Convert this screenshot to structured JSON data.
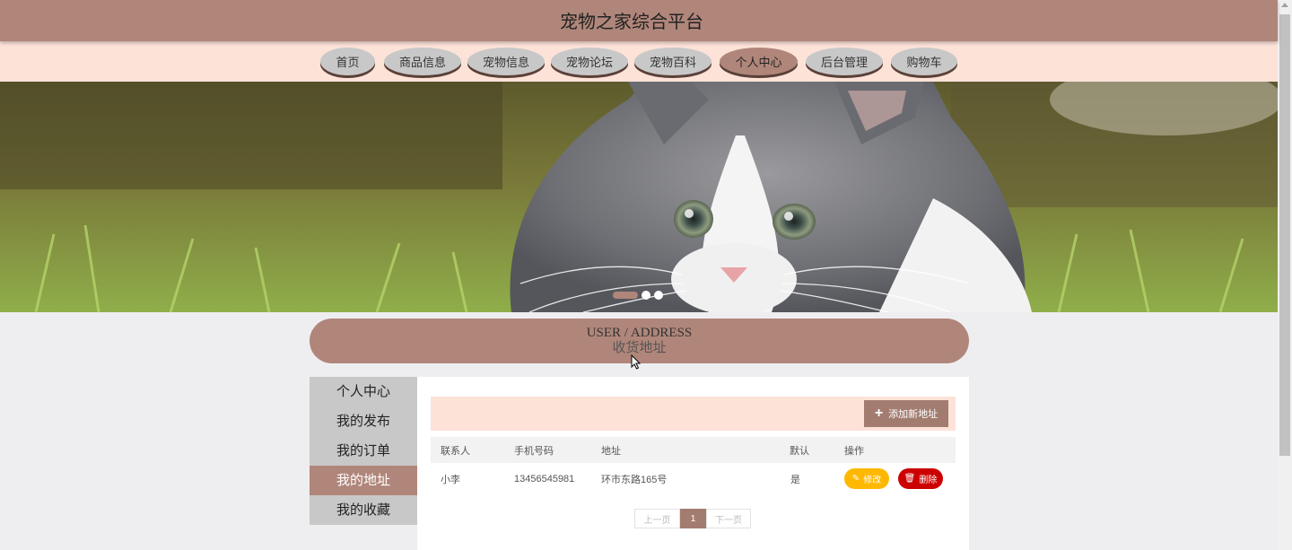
{
  "header": {
    "title": "宠物之家综合平台"
  },
  "nav": {
    "items": [
      {
        "label": "首页"
      },
      {
        "label": "商品信息"
      },
      {
        "label": "宠物信息"
      },
      {
        "label": "宠物论坛"
      },
      {
        "label": "宠物百科"
      },
      {
        "label": "个人中心"
      },
      {
        "label": "后台管理"
      },
      {
        "label": "购物车"
      }
    ],
    "active": "个人中心"
  },
  "banner": {
    "slide_count": 3,
    "active_slide": 1
  },
  "section": {
    "title_en": "USER / ADDRESS",
    "title_cn": "收货地址"
  },
  "sidebar": {
    "items": [
      {
        "label": "个人中心"
      },
      {
        "label": "我的发布"
      },
      {
        "label": "我的订单"
      },
      {
        "label": "我的地址"
      },
      {
        "label": "我的收藏"
      }
    ],
    "active": "我的地址"
  },
  "toolbar": {
    "add_label": "添加新地址",
    "add_icon": "plus-icon"
  },
  "table": {
    "headers": [
      "联系人",
      "手机号码",
      "地址",
      "默认",
      "操作"
    ],
    "rows": [
      {
        "contact": "小李",
        "phone": "13456545981",
        "address": "环市东路165号",
        "default": "是",
        "edit_label": "修改",
        "delete_label": "删除"
      }
    ]
  },
  "pagination": {
    "prev": "上一页",
    "current": "1",
    "next": "下一页"
  },
  "colors": {
    "brand": "#b0867a",
    "nav_bg": "#fde2d8",
    "edit": "#ffb800",
    "delete": "#cc0000"
  }
}
